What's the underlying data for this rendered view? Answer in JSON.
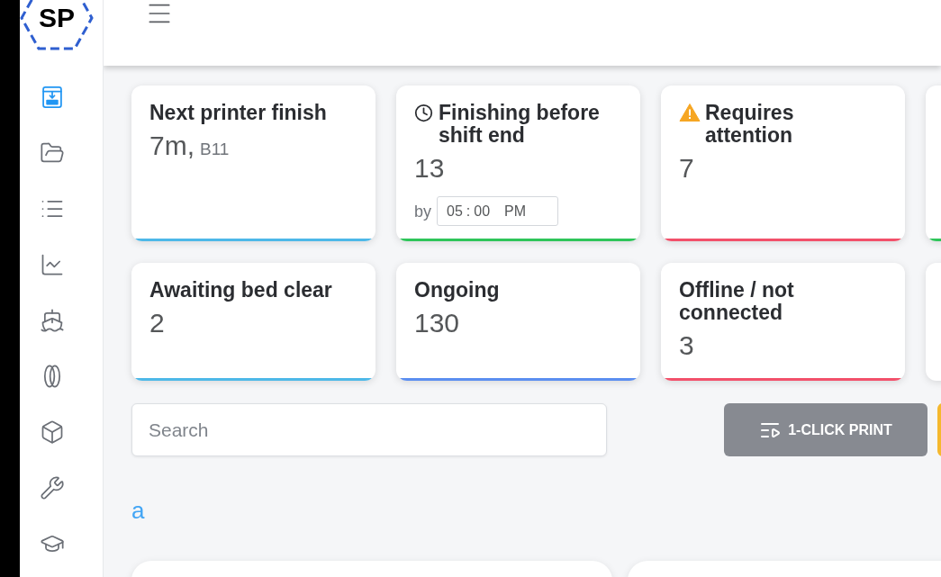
{
  "logo": {
    "text": "SP"
  },
  "sidebar": {
    "items": [
      {
        "selected": true
      },
      {
        "selected": false
      },
      {
        "selected": false
      },
      {
        "selected": false
      },
      {
        "selected": false
      },
      {
        "selected": false
      },
      {
        "selected": false
      },
      {
        "selected": false
      },
      {
        "selected": false
      }
    ]
  },
  "cards": [
    {
      "kind": "plain",
      "title": "Next printer finish",
      "value": "7m,",
      "detail": "B11",
      "color": "#4db8e8"
    },
    {
      "kind": "deadline",
      "title": "Finishing before shift end",
      "value": "13",
      "by_label": "by",
      "time": {
        "hours": "05",
        "separator": ":",
        "minutes": "00",
        "period": "PM"
      },
      "color": "#2ec55a"
    },
    {
      "kind": "alert",
      "title": "Requires attention",
      "value": "7",
      "color": "#f2506a"
    },
    {
      "kind": "cut",
      "color": "#2ec55a"
    },
    {
      "kind": "plain",
      "title": "Awaiting bed clear",
      "value": "2",
      "color": "#4db8e8"
    },
    {
      "kind": "plain",
      "title": "Ongoing",
      "value": "130",
      "color": "#5b8ef0"
    },
    {
      "kind": "plain",
      "title": "Offline / not connected",
      "value": "3",
      "color": "#f2506a"
    },
    {
      "kind": "cut"
    }
  ],
  "search": {
    "placeholder": "Search"
  },
  "buttons": [
    {
      "label": "1-CLICK PRINT",
      "disabled": true
    },
    {
      "disabled": false
    }
  ],
  "link": "a"
}
